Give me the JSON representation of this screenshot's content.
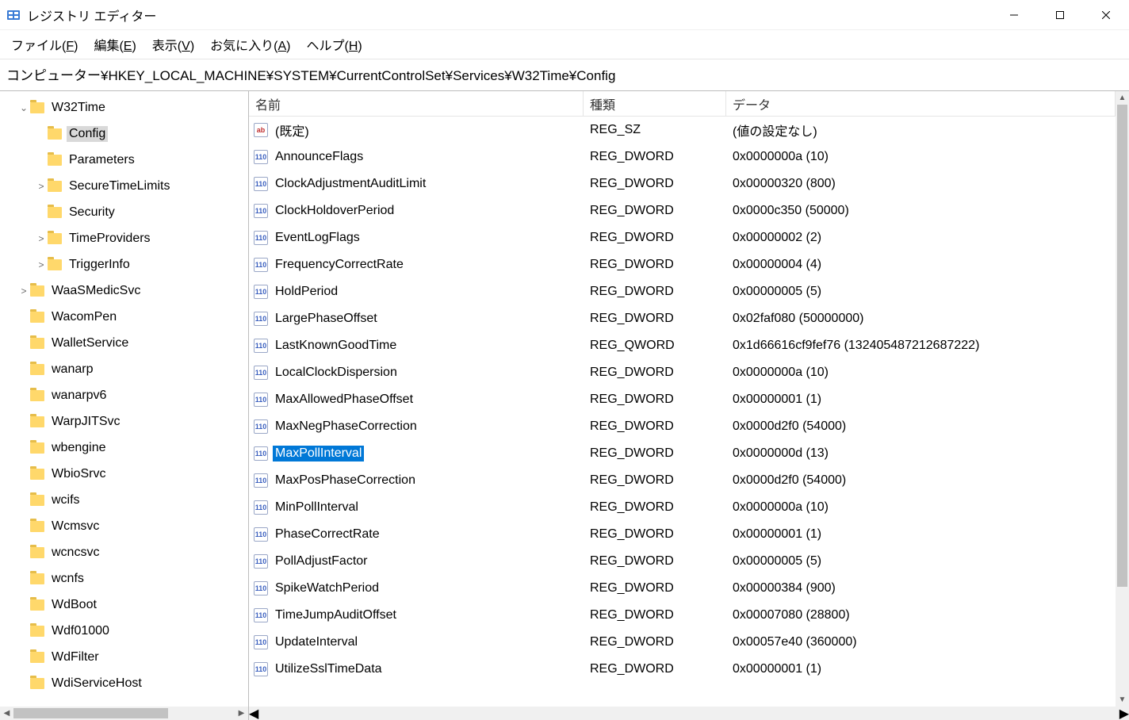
{
  "window": {
    "title": "レジストリ エディター"
  },
  "menu": {
    "file": "ファイル(F)",
    "edit": "編集(E)",
    "view": "表示(V)",
    "favorites": "お気に入り(A)",
    "help": "ヘルプ(H)"
  },
  "address": "コンピューター¥HKEY_LOCAL_MACHINE¥SYSTEM¥CurrentControlSet¥Services¥W32Time¥Config",
  "tree": [
    {
      "depth": 1,
      "expander": "open",
      "label": "W32Time",
      "selected": false
    },
    {
      "depth": 2,
      "expander": "none",
      "label": "Config",
      "selected": true
    },
    {
      "depth": 2,
      "expander": "none",
      "label": "Parameters",
      "selected": false
    },
    {
      "depth": 2,
      "expander": "closed",
      "label": "SecureTimeLimits",
      "selected": false
    },
    {
      "depth": 2,
      "expander": "none",
      "label": "Security",
      "selected": false
    },
    {
      "depth": 2,
      "expander": "closed",
      "label": "TimeProviders",
      "selected": false
    },
    {
      "depth": 2,
      "expander": "closed",
      "label": "TriggerInfo",
      "selected": false
    },
    {
      "depth": 1,
      "expander": "closed",
      "label": "WaaSMedicSvc",
      "selected": false
    },
    {
      "depth": 1,
      "expander": "none",
      "label": "WacomPen",
      "selected": false
    },
    {
      "depth": 1,
      "expander": "none",
      "label": "WalletService",
      "selected": false
    },
    {
      "depth": 1,
      "expander": "none",
      "label": "wanarp",
      "selected": false
    },
    {
      "depth": 1,
      "expander": "none",
      "label": "wanarpv6",
      "selected": false
    },
    {
      "depth": 1,
      "expander": "none",
      "label": "WarpJITSvc",
      "selected": false
    },
    {
      "depth": 1,
      "expander": "none",
      "label": "wbengine",
      "selected": false
    },
    {
      "depth": 1,
      "expander": "none",
      "label": "WbioSrvc",
      "selected": false
    },
    {
      "depth": 1,
      "expander": "none",
      "label": "wcifs",
      "selected": false
    },
    {
      "depth": 1,
      "expander": "none",
      "label": "Wcmsvc",
      "selected": false
    },
    {
      "depth": 1,
      "expander": "none",
      "label": "wcncsvc",
      "selected": false
    },
    {
      "depth": 1,
      "expander": "none",
      "label": "wcnfs",
      "selected": false
    },
    {
      "depth": 1,
      "expander": "none",
      "label": "WdBoot",
      "selected": false
    },
    {
      "depth": 1,
      "expander": "none",
      "label": "Wdf01000",
      "selected": false
    },
    {
      "depth": 1,
      "expander": "none",
      "label": "WdFilter",
      "selected": false
    },
    {
      "depth": 1,
      "expander": "none",
      "label": "WdiServiceHost",
      "selected": false
    }
  ],
  "columns": {
    "name": "名前",
    "type": "種類",
    "data": "データ"
  },
  "values": [
    {
      "icon": "str",
      "name": "(既定)",
      "type": "REG_SZ",
      "data": "(値の設定なし)",
      "selected": false
    },
    {
      "icon": "bin",
      "name": "AnnounceFlags",
      "type": "REG_DWORD",
      "data": "0x0000000a (10)",
      "selected": false
    },
    {
      "icon": "bin",
      "name": "ClockAdjustmentAuditLimit",
      "type": "REG_DWORD",
      "data": "0x00000320 (800)",
      "selected": false
    },
    {
      "icon": "bin",
      "name": "ClockHoldoverPeriod",
      "type": "REG_DWORD",
      "data": "0x0000c350 (50000)",
      "selected": false
    },
    {
      "icon": "bin",
      "name": "EventLogFlags",
      "type": "REG_DWORD",
      "data": "0x00000002 (2)",
      "selected": false
    },
    {
      "icon": "bin",
      "name": "FrequencyCorrectRate",
      "type": "REG_DWORD",
      "data": "0x00000004 (4)",
      "selected": false
    },
    {
      "icon": "bin",
      "name": "HoldPeriod",
      "type": "REG_DWORD",
      "data": "0x00000005 (5)",
      "selected": false
    },
    {
      "icon": "bin",
      "name": "LargePhaseOffset",
      "type": "REG_DWORD",
      "data": "0x02faf080 (50000000)",
      "selected": false
    },
    {
      "icon": "bin",
      "name": "LastKnownGoodTime",
      "type": "REG_QWORD",
      "data": "0x1d66616cf9fef76 (132405487212687222)",
      "selected": false
    },
    {
      "icon": "bin",
      "name": "LocalClockDispersion",
      "type": "REG_DWORD",
      "data": "0x0000000a (10)",
      "selected": false
    },
    {
      "icon": "bin",
      "name": "MaxAllowedPhaseOffset",
      "type": "REG_DWORD",
      "data": "0x00000001 (1)",
      "selected": false
    },
    {
      "icon": "bin",
      "name": "MaxNegPhaseCorrection",
      "type": "REG_DWORD",
      "data": "0x0000d2f0 (54000)",
      "selected": false
    },
    {
      "icon": "bin",
      "name": "MaxPollInterval",
      "type": "REG_DWORD",
      "data": "0x0000000d (13)",
      "selected": true
    },
    {
      "icon": "bin",
      "name": "MaxPosPhaseCorrection",
      "type": "REG_DWORD",
      "data": "0x0000d2f0 (54000)",
      "selected": false
    },
    {
      "icon": "bin",
      "name": "MinPollInterval",
      "type": "REG_DWORD",
      "data": "0x0000000a (10)",
      "selected": false
    },
    {
      "icon": "bin",
      "name": "PhaseCorrectRate",
      "type": "REG_DWORD",
      "data": "0x00000001 (1)",
      "selected": false
    },
    {
      "icon": "bin",
      "name": "PollAdjustFactor",
      "type": "REG_DWORD",
      "data": "0x00000005 (5)",
      "selected": false
    },
    {
      "icon": "bin",
      "name": "SpikeWatchPeriod",
      "type": "REG_DWORD",
      "data": "0x00000384 (900)",
      "selected": false
    },
    {
      "icon": "bin",
      "name": "TimeJumpAuditOffset",
      "type": "REG_DWORD",
      "data": "0x00007080 (28800)",
      "selected": false
    },
    {
      "icon": "bin",
      "name": "UpdateInterval",
      "type": "REG_DWORD",
      "data": "0x00057e40 (360000)",
      "selected": false
    },
    {
      "icon": "bin",
      "name": "UtilizeSslTimeData",
      "type": "REG_DWORD",
      "data": "0x00000001 (1)",
      "selected": false
    }
  ]
}
